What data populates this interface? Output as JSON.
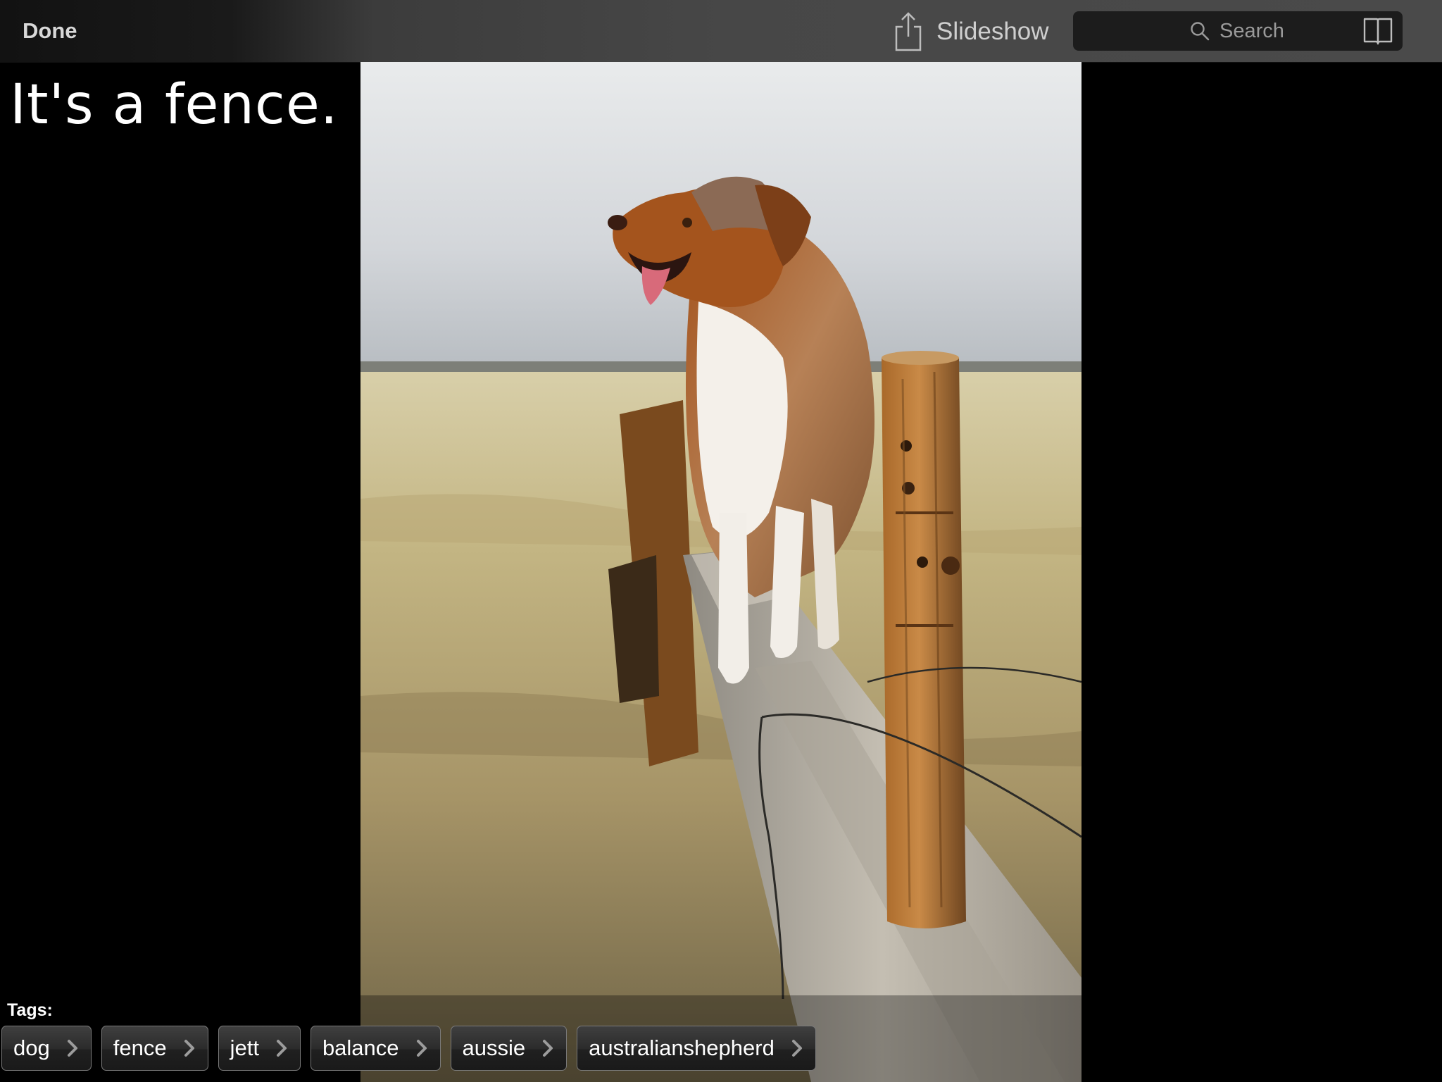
{
  "toolbar": {
    "done_label": "Done",
    "slideshow_label": "Slideshow",
    "search_placeholder": "Search"
  },
  "photo": {
    "caption": "It's a fence."
  },
  "tags": {
    "label": "Tags:",
    "items": [
      {
        "label": "dog"
      },
      {
        "label": "fence"
      },
      {
        "label": "jett"
      },
      {
        "label": "balance"
      },
      {
        "label": "aussie"
      },
      {
        "label": "australianshepherd"
      }
    ]
  },
  "icons": {
    "share": "share-icon",
    "search": "search-icon",
    "book": "book-icon",
    "chevron": "chevron-right-icon"
  }
}
